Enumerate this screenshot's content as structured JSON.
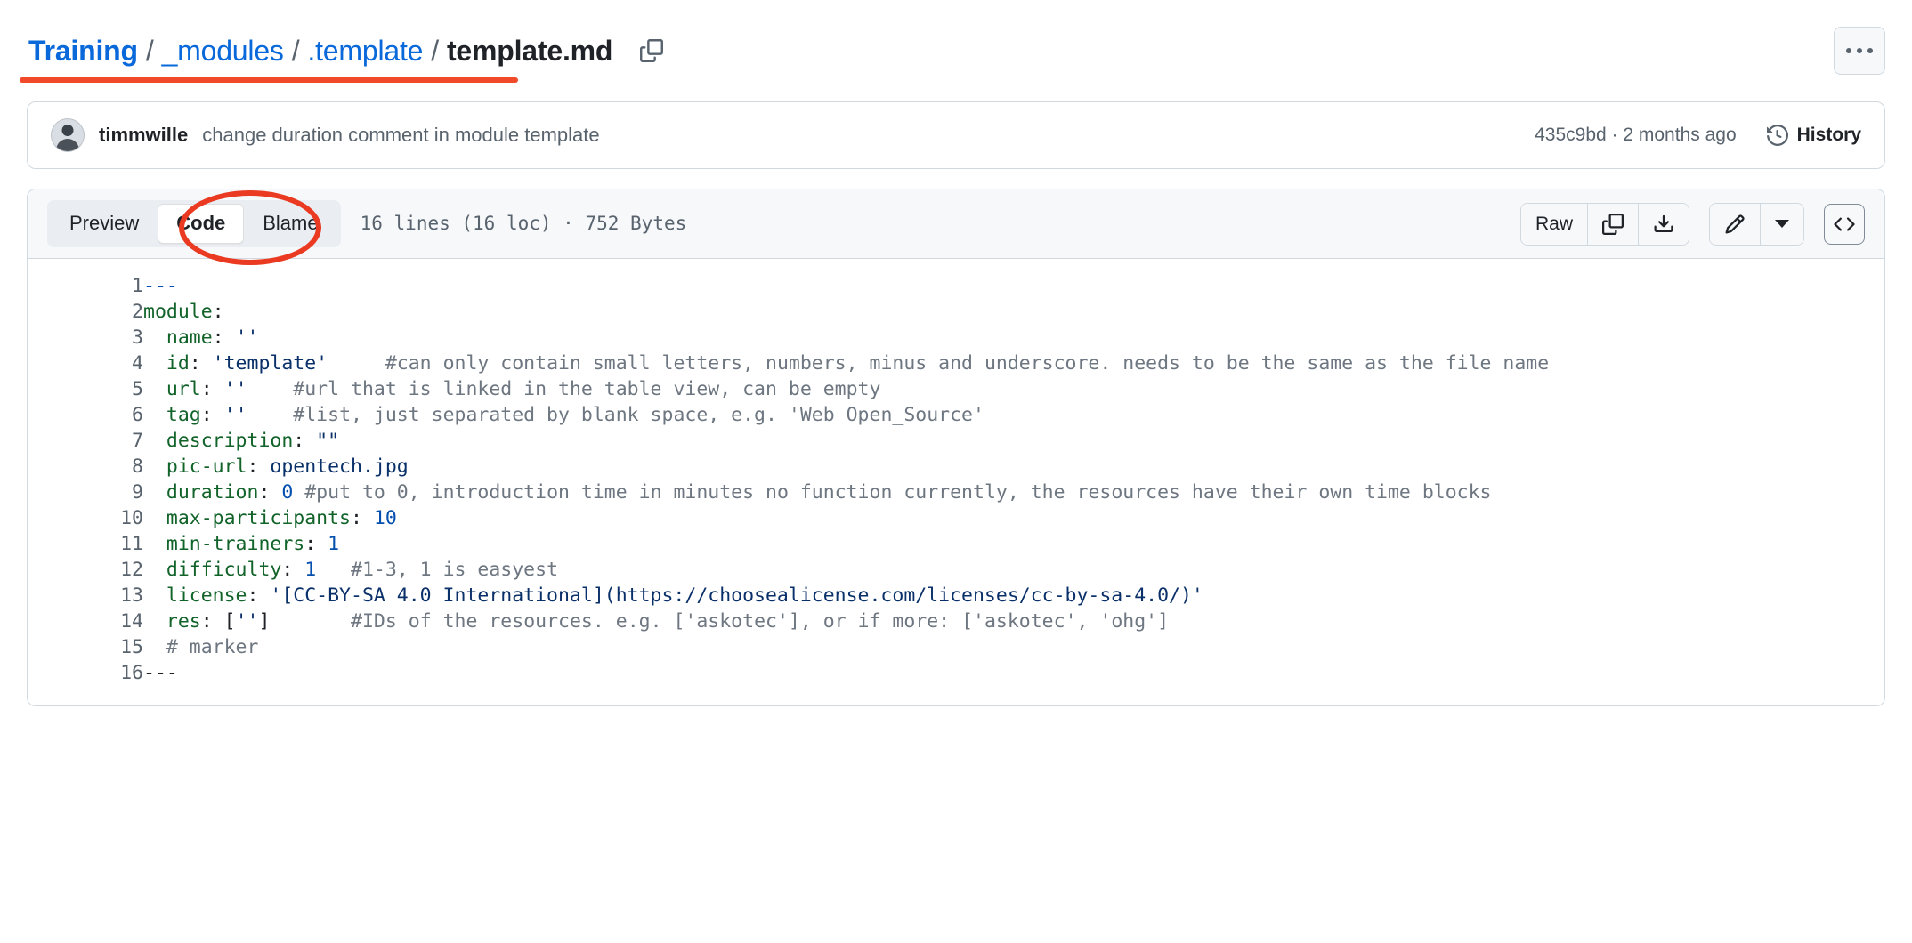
{
  "breadcrumb": {
    "items": [
      {
        "label": "Training",
        "type": "link-bold"
      },
      {
        "label": "_modules",
        "type": "link"
      },
      {
        "label": ".template",
        "type": "link"
      },
      {
        "label": "template.md",
        "type": "current"
      }
    ],
    "separator": "/",
    "copy_path_icon": "copy-icon"
  },
  "header": {
    "more_button_icon": "kebab-horizontal-icon"
  },
  "commit": {
    "author": "timmwille",
    "message": "change duration comment in module template",
    "sha": "435c9bd",
    "separator": "·",
    "relative_time": "2 months ago",
    "history_label": "History",
    "history_icon": "history-clock-icon",
    "avatar_alt": "timmwille avatar"
  },
  "file_header": {
    "tabs": [
      {
        "label": "Preview",
        "active": false
      },
      {
        "label": "Code",
        "active": true
      },
      {
        "label": "Blame",
        "active": false
      }
    ],
    "stats": "16 lines (16 loc) · 752 Bytes",
    "raw_label": "Raw",
    "copy_icon": "copy-icon",
    "download_icon": "download-icon",
    "edit_icon": "pencil-icon",
    "edit_dropdown_icon": "chevron-down-icon",
    "symbols_icon": "code-brackets-icon"
  },
  "annotations": {
    "breadcrumb_underline_color": "#f04a28",
    "code_tab_ellipse_color": "#ea3a21"
  },
  "code": {
    "language": "yaml",
    "lines": [
      {
        "n": "1",
        "tokens": [
          {
            "t": "marker",
            "v": "---"
          }
        ]
      },
      {
        "n": "2",
        "tokens": [
          {
            "t": "key",
            "v": "module"
          },
          {
            "t": "pun",
            "v": ":"
          }
        ]
      },
      {
        "n": "3",
        "tokens": [
          {
            "t": "pun",
            "v": "  "
          },
          {
            "t": "key",
            "v": "name"
          },
          {
            "t": "pun",
            "v": ": "
          },
          {
            "t": "str",
            "v": "''"
          }
        ]
      },
      {
        "n": "4",
        "tokens": [
          {
            "t": "pun",
            "v": "  "
          },
          {
            "t": "key",
            "v": "id"
          },
          {
            "t": "pun",
            "v": ": "
          },
          {
            "t": "str",
            "v": "'template'"
          },
          {
            "t": "com",
            "v": "     #can only contain small letters, numbers, minus and underscore. needs to be the same as the file name"
          }
        ]
      },
      {
        "n": "5",
        "tokens": [
          {
            "t": "pun",
            "v": "  "
          },
          {
            "t": "key",
            "v": "url"
          },
          {
            "t": "pun",
            "v": ": "
          },
          {
            "t": "str",
            "v": "''"
          },
          {
            "t": "com",
            "v": "    #url that is linked in the table view, can be empty"
          }
        ]
      },
      {
        "n": "6",
        "tokens": [
          {
            "t": "pun",
            "v": "  "
          },
          {
            "t": "key",
            "v": "tag"
          },
          {
            "t": "pun",
            "v": ": "
          },
          {
            "t": "str",
            "v": "''"
          },
          {
            "t": "com",
            "v": "    #list, just separated by blank space, e.g. 'Web Open_Source'"
          }
        ]
      },
      {
        "n": "7",
        "tokens": [
          {
            "t": "pun",
            "v": "  "
          },
          {
            "t": "key",
            "v": "description"
          },
          {
            "t": "pun",
            "v": ": "
          },
          {
            "t": "str",
            "v": "\"\""
          }
        ]
      },
      {
        "n": "8",
        "tokens": [
          {
            "t": "pun",
            "v": "  "
          },
          {
            "t": "key",
            "v": "pic-url"
          },
          {
            "t": "pun",
            "v": ": "
          },
          {
            "t": "str",
            "v": "opentech.jpg"
          }
        ]
      },
      {
        "n": "9",
        "tokens": [
          {
            "t": "pun",
            "v": "  "
          },
          {
            "t": "key",
            "v": "duration"
          },
          {
            "t": "pun",
            "v": ": "
          },
          {
            "t": "num",
            "v": "0"
          },
          {
            "t": "com",
            "v": " #put to 0, introduction time in minutes no function currently, the resources have their own time blocks"
          }
        ]
      },
      {
        "n": "10",
        "tokens": [
          {
            "t": "pun",
            "v": "  "
          },
          {
            "t": "key",
            "v": "max-participants"
          },
          {
            "t": "pun",
            "v": ": "
          },
          {
            "t": "num",
            "v": "10"
          }
        ]
      },
      {
        "n": "11",
        "tokens": [
          {
            "t": "pun",
            "v": "  "
          },
          {
            "t": "key",
            "v": "min-trainers"
          },
          {
            "t": "pun",
            "v": ": "
          },
          {
            "t": "num",
            "v": "1"
          }
        ]
      },
      {
        "n": "12",
        "tokens": [
          {
            "t": "pun",
            "v": "  "
          },
          {
            "t": "key",
            "v": "difficulty"
          },
          {
            "t": "pun",
            "v": ": "
          },
          {
            "t": "num",
            "v": "1"
          },
          {
            "t": "com",
            "v": "   #1-3, 1 is easyest"
          }
        ]
      },
      {
        "n": "13",
        "tokens": [
          {
            "t": "pun",
            "v": "  "
          },
          {
            "t": "key",
            "v": "license"
          },
          {
            "t": "pun",
            "v": ": "
          },
          {
            "t": "str",
            "v": "'[CC-BY-SA 4.0 International](https://choosealicense.com/licenses/cc-by-sa-4.0/)'"
          }
        ]
      },
      {
        "n": "14",
        "tokens": [
          {
            "t": "pun",
            "v": "  "
          },
          {
            "t": "key",
            "v": "res"
          },
          {
            "t": "pun",
            "v": ": ["
          },
          {
            "t": "str",
            "v": "''"
          },
          {
            "t": "pun",
            "v": "]"
          },
          {
            "t": "com",
            "v": "       #IDs of the resources. e.g. ['askotec'], or if more: ['askotec', 'ohg']"
          }
        ]
      },
      {
        "n": "15",
        "tokens": [
          {
            "t": "pun",
            "v": "  "
          },
          {
            "t": "com",
            "v": "# marker"
          }
        ]
      },
      {
        "n": "16",
        "tokens": [
          {
            "t": "pun",
            "v": "---"
          }
        ]
      }
    ]
  },
  "colors": {
    "link": "#0969da",
    "key": "#116329",
    "string": "#0a3069",
    "number": "#0550ae",
    "comment": "#6e7781",
    "border": "#d1d9e0",
    "muted_bg": "#f6f8fa"
  }
}
